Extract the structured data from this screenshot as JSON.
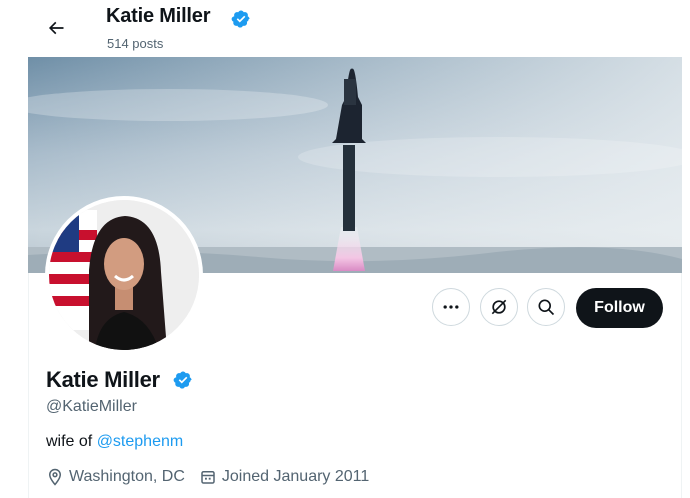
{
  "header": {
    "back_icon": "arrow-left-icon",
    "name": "Katie Miller",
    "posts": "514 posts"
  },
  "profile": {
    "name": "Katie Miller",
    "handle": "@KatieMiller",
    "verified": true,
    "bio_prefix": "wife of ",
    "bio_mention": "@stephenm",
    "location": "Washington, DC",
    "joined": "Joined January 2011"
  },
  "actions": {
    "more_icon": "more-dots-icon",
    "grok_icon": "grok-icon",
    "search_icon": "search-icon",
    "follow_label": "Follow"
  },
  "colors": {
    "accent": "#1d9bf0",
    "text_primary": "#0f1419",
    "text_secondary": "#536471",
    "follow_bg": "#0f1419"
  }
}
